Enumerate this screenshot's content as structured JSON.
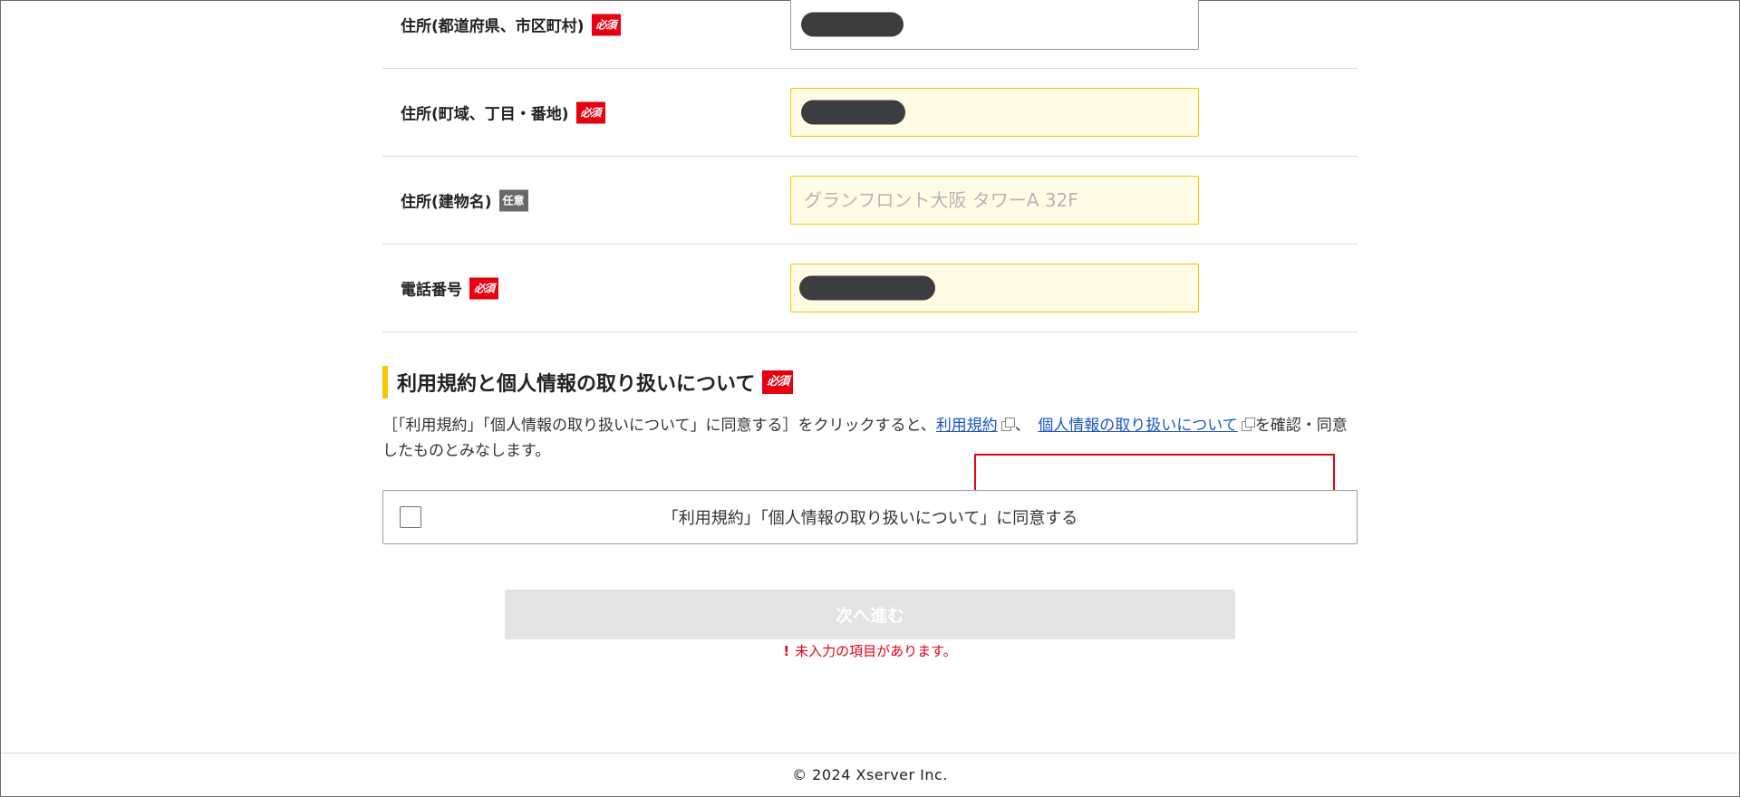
{
  "form": {
    "rows": [
      {
        "label": "住所(都道府県、市区町村)",
        "badge": "必須"
      },
      {
        "label": "住所(町域、丁目・番地)",
        "badge": "必須"
      },
      {
        "label": "住所(建物名)",
        "badge": "任意",
        "placeholder": "グランフロント大阪 タワーA 32F"
      },
      {
        "label": "電話番号",
        "badge": "必須"
      }
    ]
  },
  "terms": {
    "heading": "利用規約と個人情報の取り扱いについて",
    "badge": "必須",
    "text_before": "［「利用規約」「個人情報の取り扱いについて」に同意する］をクリックすると、",
    "link_terms": "利用規約",
    "separator": "、",
    "link_privacy": "個人情報の取り扱いについて",
    "text_after": "を確認・同意したものとみなします。",
    "checkbox_label": "「利用規約」「個人情報の取り扱いについて」に同意する"
  },
  "actions": {
    "next_label": "次へ進む",
    "error_icon": "!",
    "error_text": "未入力の項目があります。"
  },
  "footer": {
    "copyright": "© 2024 Xserver Inc."
  },
  "colors": {
    "required_badge": "#e60012",
    "optional_badge": "#6a6a6a",
    "heading_bar": "#f7c600",
    "field_bg": "#fffbe5",
    "link": "#1a55c5"
  }
}
